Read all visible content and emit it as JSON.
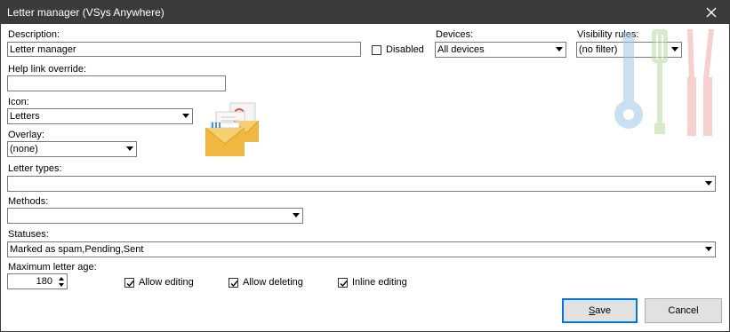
{
  "window": {
    "title": "Letter manager (VSys Anywhere)"
  },
  "description": {
    "label": "Description:",
    "value": "Letter manager"
  },
  "disabled": {
    "label": "Disabled",
    "checked": false
  },
  "devices": {
    "label": "Devices:",
    "value": "All devices"
  },
  "visibility": {
    "label": "Visibility rules:",
    "value": "(no filter)"
  },
  "help_link": {
    "label": "Help link override:",
    "value": ""
  },
  "icon": {
    "label": "Icon:",
    "value": "Letters",
    "preview": "envelope-icon"
  },
  "overlay": {
    "label": "Overlay:",
    "value": "(none)"
  },
  "letter_types": {
    "label": "Letter types:",
    "value": ""
  },
  "methods": {
    "label": "Methods:",
    "value": ""
  },
  "statuses": {
    "label": "Statuses:",
    "value": "Marked as spam,Pending,Sent"
  },
  "max_age": {
    "label": "Maximum letter age:",
    "value": "180"
  },
  "options": [
    {
      "label": "Allow editing",
      "checked": true
    },
    {
      "label": "Allow deleting",
      "checked": true
    },
    {
      "label": "Inline editing",
      "checked": true
    }
  ],
  "buttons": {
    "save_mnemonic": "S",
    "save_rest": "ave",
    "cancel": "Cancel"
  },
  "colors": {
    "titlebar": "#3b3b3b",
    "accent": "#0078d7",
    "envelope": "#f0b840"
  }
}
